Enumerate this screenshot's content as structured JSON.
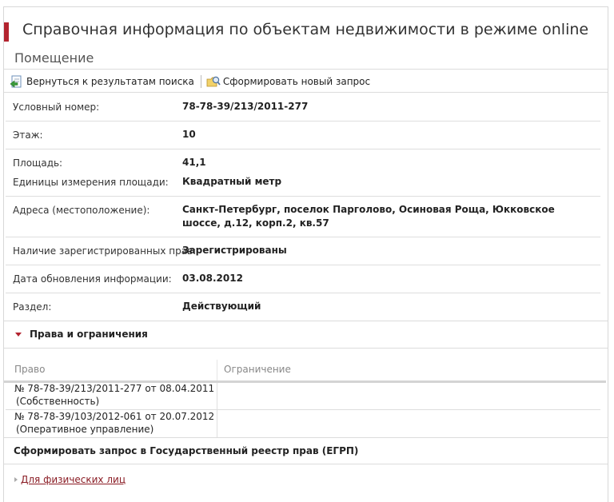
{
  "header": {
    "title": "Справочная информация по объектам недвижимости в режиме online",
    "subtitle": "Помещение"
  },
  "toolbar": {
    "back_label": "Вернуться к результатам поиска",
    "new_request_label": "Сформировать новый запрос"
  },
  "properties": [
    {
      "label": "Условный номер:",
      "value": "78-78-39/213/2011-277"
    },
    {
      "label": "Этаж:",
      "value": "10"
    },
    {
      "label": "Площадь:",
      "value": "41,1"
    },
    {
      "label": "Единицы измерения площади:",
      "value": "Квадратный метр"
    },
    {
      "label": "Адреса (местоположение):",
      "value": "Санкт-Петербург, поселок Парголово, Осиновая Роща, Юкковское шоссе, д.12, корп.2, кв.57"
    },
    {
      "label": "Наличие зарегистрированных прав:",
      "value": "Зарегистрированы"
    },
    {
      "label": "Дата обновления информации:",
      "value": "03.08.2012"
    },
    {
      "label": "Раздел:",
      "value": "Действующий"
    }
  ],
  "rights_section": {
    "title": "Права и ограничения",
    "columns": [
      "Право",
      "Ограничение"
    ],
    "rows": [
      {
        "right_line1": "№ 78-78-39/213/2011-277  от 08.04.2011",
        "right_line2": "(Собственность)",
        "restriction": ""
      },
      {
        "right_line1": "№ 78-78-39/103/2012-061  от 20.07.2012",
        "right_line2": "(Оперативное управление)",
        "restriction": ""
      }
    ]
  },
  "egrp": {
    "title": "Сформировать запрос в Государственный реестр прав (ЕГРП)",
    "link_label": "Для физических лиц"
  },
  "colors": {
    "accent": "#b3242f",
    "link": "#8a1c24"
  }
}
